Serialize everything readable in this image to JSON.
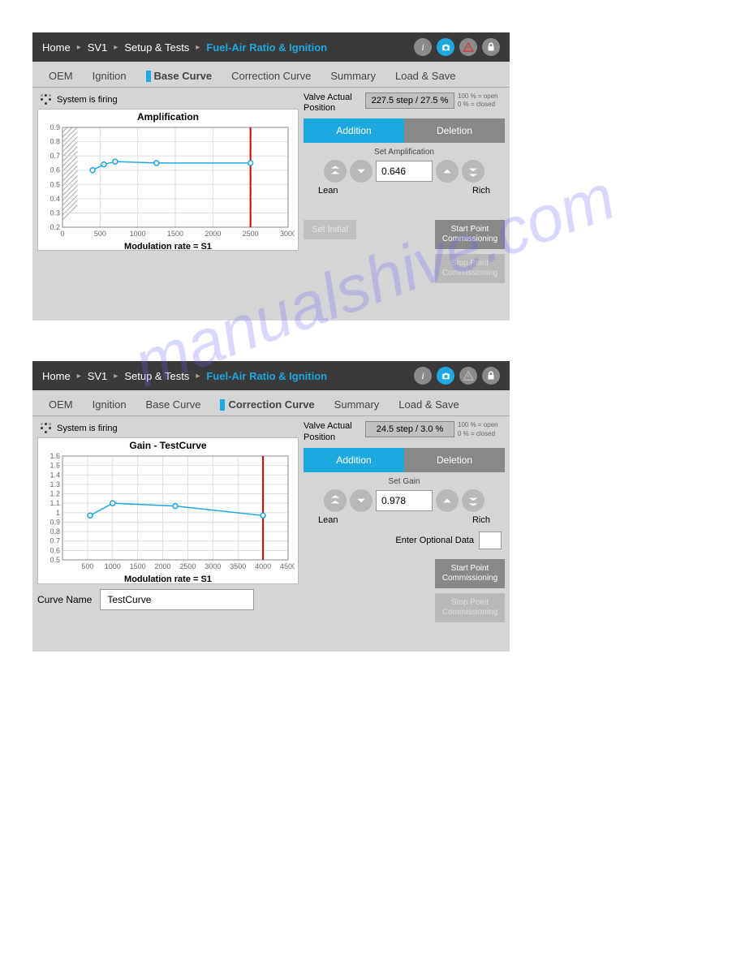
{
  "watermark": "manualshive.com",
  "screens": [
    {
      "breadcrumb": [
        "Home",
        "SV1",
        "Setup & Tests",
        "Fuel-Air Ratio & Ignition"
      ],
      "tabs": [
        "OEM",
        "Ignition",
        "Base Curve",
        "Correction Curve",
        "Summary",
        "Load & Save"
      ],
      "active_tab": 2,
      "status": "System is firing",
      "chart_title": "Amplification",
      "xlabel": "Modulation rate = S1",
      "valve_label": "Valve Actual Position",
      "valve_value": "227.5 step / 27.5 %",
      "valve_open": "100 % = open",
      "valve_closed": "0 % = closed",
      "addition": "Addition",
      "deletion": "Deletion",
      "set_label": "Set Amplification",
      "set_value": "0.646",
      "lean": "Lean",
      "rich": "Rich",
      "set_initial": "Set Initial",
      "start_commission": "Start Point Commissioning",
      "stop_commission": "Stop Point Commissioning"
    },
    {
      "breadcrumb": [
        "Home",
        "SV1",
        "Setup & Tests",
        "Fuel-Air Ratio & Ignition"
      ],
      "tabs": [
        "OEM",
        "Ignition",
        "Base Curve",
        "Correction Curve",
        "Summary",
        "Load & Save"
      ],
      "active_tab": 3,
      "status": "System is firing",
      "chart_title": "Gain - TestCurve",
      "xlabel": "Modulation rate = S1",
      "valve_label": "Valve Actual Position",
      "valve_value": "24.5 step / 3.0 %",
      "valve_open": "100 % = open",
      "valve_closed": "0 % = closed",
      "addition": "Addition",
      "deletion": "Deletion",
      "set_label": "Set Gain",
      "set_value": "0.978",
      "lean": "Lean",
      "rich": "Rich",
      "optional_label": "Enter Optional Data",
      "start_commission": "Start Point Commissioning",
      "stop_commission": "Stop Point Commissioning",
      "curve_name_label": "Curve Name",
      "curve_name_value": "TestCurve"
    }
  ],
  "chart_data": [
    {
      "type": "line",
      "title": "Amplification",
      "xlabel": "Modulation rate = S1",
      "ylabel": "",
      "xlim": [
        0,
        3000
      ],
      "ylim": [
        0.2,
        0.9
      ],
      "xticks": [
        0,
        500,
        1000,
        1500,
        2000,
        2500,
        3000
      ],
      "yticks": [
        0.2,
        0.3,
        0.4,
        0.5,
        0.6,
        0.7,
        0.8,
        0.9
      ],
      "series": [
        {
          "name": "Amplification",
          "x": [
            400,
            550,
            700,
            1250,
            2500
          ],
          "y": [
            0.6,
            0.64,
            0.66,
            0.65,
            0.65
          ],
          "color": "#1ea8e0"
        }
      ],
      "vline": 2500,
      "hatched_region": [
        0,
        200
      ]
    },
    {
      "type": "line",
      "title": "Gain - TestCurve",
      "xlabel": "Modulation rate = S1",
      "ylabel": "",
      "xlim": [
        0,
        4500
      ],
      "ylim": [
        0.5,
        1.6
      ],
      "xticks": [
        500,
        1000,
        1500,
        2000,
        2500,
        3000,
        3500,
        4000,
        4500
      ],
      "yticks": [
        0.5,
        0.6,
        0.7,
        0.8,
        0.9,
        1.0,
        1.1,
        1.2,
        1.3,
        1.4,
        1.5,
        1.6
      ],
      "series": [
        {
          "name": "Gain",
          "x": [
            550,
            1000,
            2250,
            4000
          ],
          "y": [
            0.97,
            1.1,
            1.07,
            0.97
          ],
          "color": "#1ea8e0"
        }
      ],
      "vline": 4000
    }
  ]
}
